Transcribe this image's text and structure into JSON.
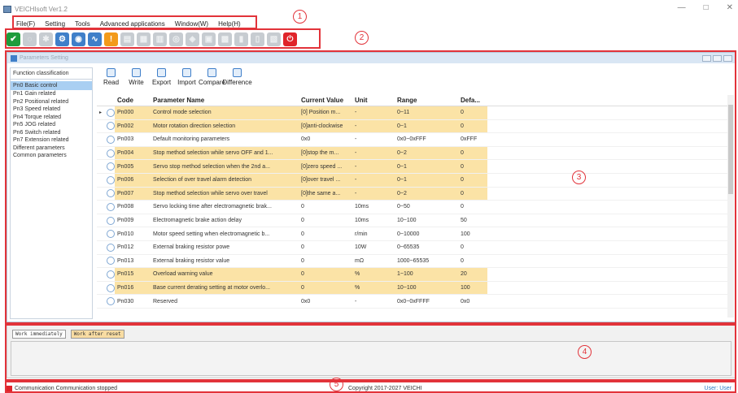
{
  "app": {
    "title": "VEICHIsoft Ver1.2"
  },
  "menu": [
    "File(F)",
    "Setting",
    "Tools",
    "Advanced applications",
    "Window(W)",
    "Help(H)"
  ],
  "annotations": [
    "1",
    "2",
    "3",
    "4",
    "5"
  ],
  "pane": {
    "title": "Parameters Setting"
  },
  "func_list": {
    "header": "Function classification",
    "items": [
      "Pn0 Basic control",
      "Pn1 Gain related",
      "Pn2 Positional related",
      "Pn3 Speed related",
      "Pn4 Torque related",
      "Pn5 JOG related",
      "Pn6 Switch related",
      "Pn7 Extension related",
      "Different parameters",
      "Common parameters"
    ]
  },
  "ops": [
    "Read",
    "Write",
    "Export",
    "Import",
    "Compare",
    "Difference"
  ],
  "table": {
    "headers": [
      "Code",
      "Parameter Name",
      "Current Value",
      "Unit",
      "Range",
      "Defa..."
    ],
    "rows": [
      {
        "code": "Pn000",
        "name": "Control mode selection",
        "current": "[0] Position m...",
        "unit": "-",
        "range": "0~11",
        "default": "0",
        "hl": true
      },
      {
        "code": "Pn002",
        "name": "Motor rotation direction selection",
        "current": "[0]anti-clockwise",
        "unit": "-",
        "range": "0~1",
        "default": "0",
        "hl": true
      },
      {
        "code": "Pn003",
        "name": "Default monitoring parameters",
        "current": "0x0",
        "unit": "-",
        "range": "0x0~0xFFF",
        "default": "0xFFF",
        "hl": false
      },
      {
        "code": "Pn004",
        "name": "Stop method selection while servo OFF and 1...",
        "current": "[0]stop the m...",
        "unit": "-",
        "range": "0~2",
        "default": "0",
        "hl": true
      },
      {
        "code": "Pn005",
        "name": "Servo stop method selection when the 2nd a...",
        "current": "[0]zero speed ...",
        "unit": "-",
        "range": "0~1",
        "default": "0",
        "hl": true
      },
      {
        "code": "Pn006",
        "name": "Selection of over travel alarm detection",
        "current": "[0]over travel ...",
        "unit": "-",
        "range": "0~1",
        "default": "0",
        "hl": true
      },
      {
        "code": "Pn007",
        "name": "Stop method selection while servo over travel",
        "current": "[0]the same a...",
        "unit": "-",
        "range": "0~2",
        "default": "0",
        "hl": true
      },
      {
        "code": "Pn008",
        "name": "Servo locking time after electromagnetic brak...",
        "current": "0",
        "unit": "10ms",
        "range": "0~50",
        "default": "0",
        "hl": false
      },
      {
        "code": "Pn009",
        "name": "Electromagnetic brake action delay",
        "current": "0",
        "unit": "10ms",
        "range": "10~100",
        "default": "50",
        "hl": false
      },
      {
        "code": "Pn010",
        "name": "Motor speed setting when electromagnetic b...",
        "current": "0",
        "unit": "r/min",
        "range": "0~10000",
        "default": "100",
        "hl": false
      },
      {
        "code": "Pn012",
        "name": "External braking resistor powe",
        "current": "0",
        "unit": "10W",
        "range": "0~65535",
        "default": "0",
        "hl": false
      },
      {
        "code": "Pn013",
        "name": "External braking resistor value",
        "current": "0",
        "unit": "mΩ",
        "range": "1000~65535",
        "default": "0",
        "hl": false
      },
      {
        "code": "Pn015",
        "name": "Overload warning value",
        "current": "0",
        "unit": "%",
        "range": "1~100",
        "default": "20",
        "hl": true
      },
      {
        "code": "Pn016",
        "name": "Base current derating setting at motor overlo...",
        "current": "0",
        "unit": "%",
        "range": "10~100",
        "default": "100",
        "hl": true
      },
      {
        "code": "Pn030",
        "name": "Reserved",
        "current": "0x0",
        "unit": "-",
        "range": "0x0~0xFFFF",
        "default": "0x0",
        "hl": false
      }
    ]
  },
  "legend": {
    "immediate": "Work immediately",
    "after_reset": "Work after reset"
  },
  "status": {
    "comm": "Communication  Communication stopped",
    "copyright": "Copyright 2017-2027 VEICHI",
    "user": "User: User"
  }
}
